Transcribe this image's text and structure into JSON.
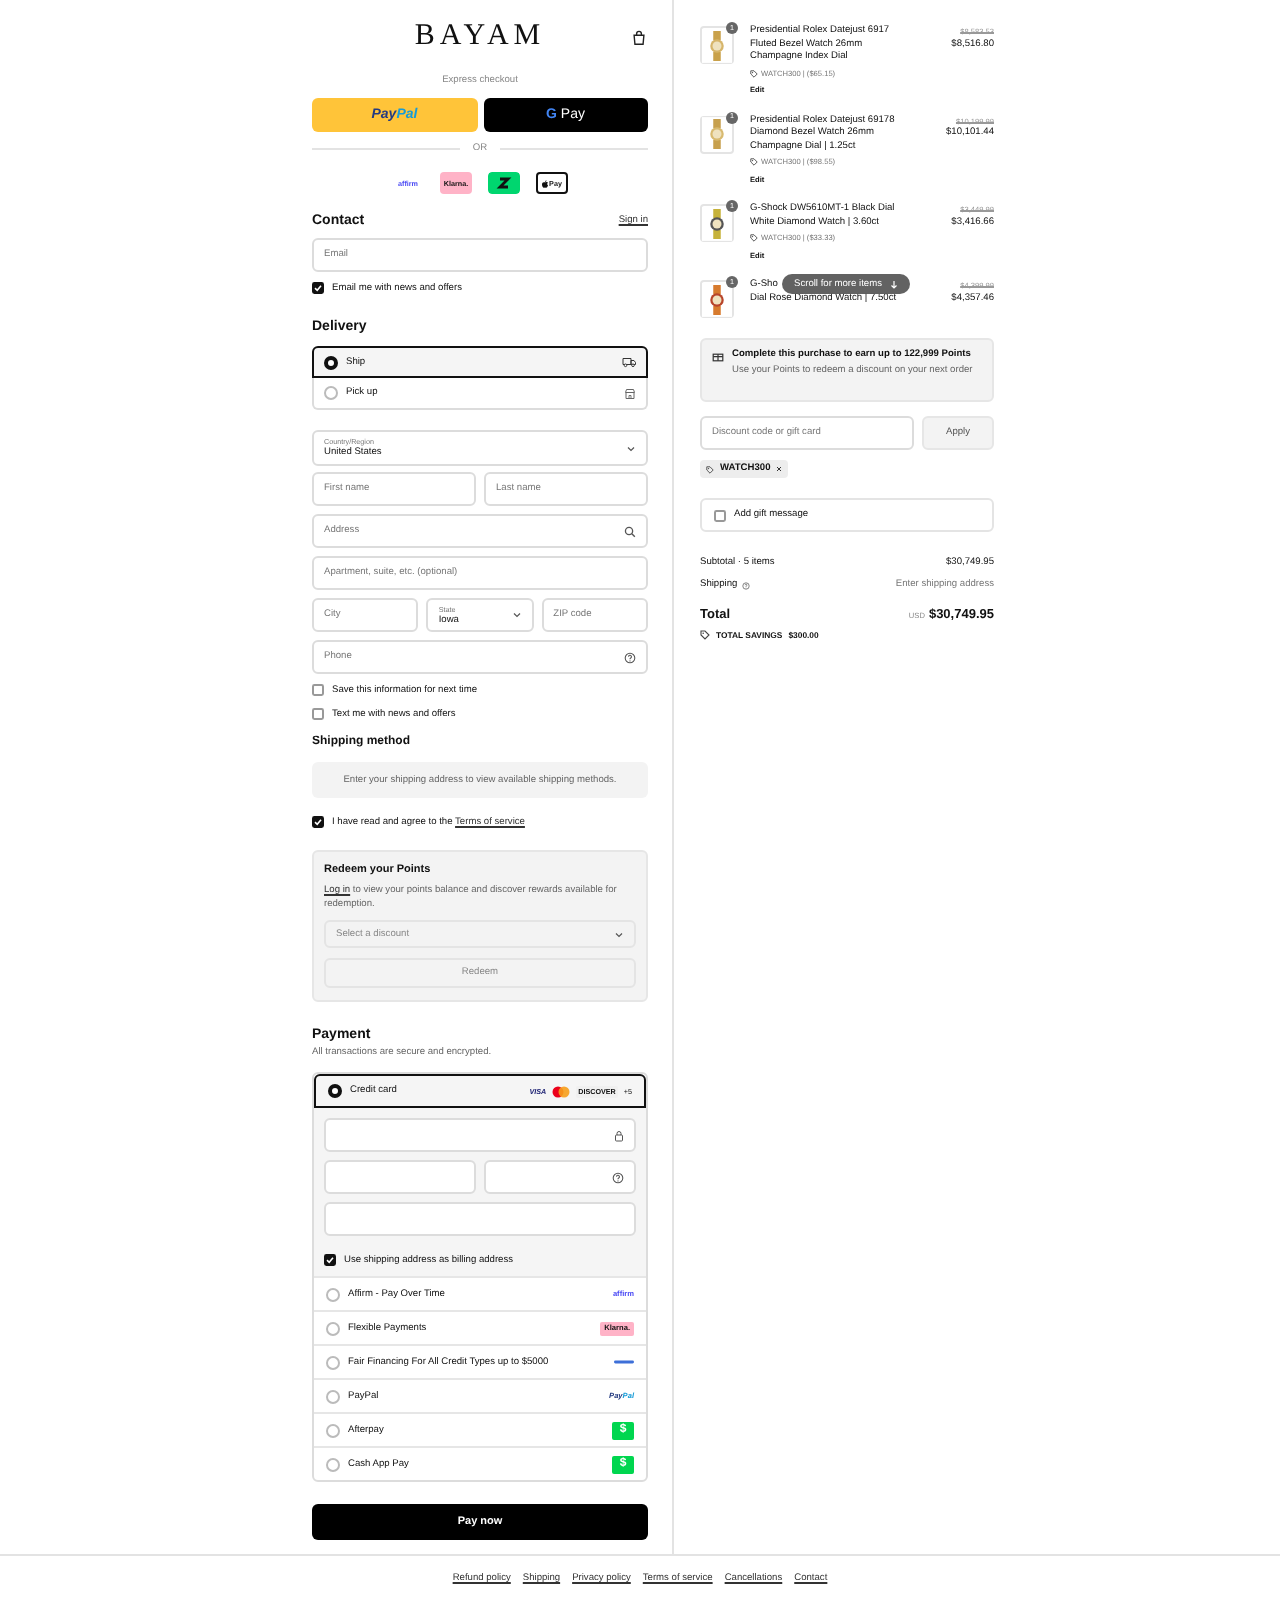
{
  "header": {
    "logo": "BAYAM"
  },
  "express": {
    "label": "Express checkout",
    "buttons": [
      {
        "kind": "paypal",
        "label": "Pay",
        "label_2": "Pal"
      },
      {
        "kind": "gpay",
        "mark": "G",
        "label": "Pay"
      }
    ],
    "divider": "OR",
    "methods": [
      {
        "kind": "affirm",
        "label": "affirm"
      },
      {
        "kind": "klarna",
        "label": "Klarna."
      },
      {
        "kind": "sezzle"
      },
      {
        "kind": "applepay",
        "label": "Pay"
      }
    ]
  },
  "contact": {
    "title": "Contact",
    "link": "Sign in",
    "email": {
      "placeholder": "Email"
    },
    "news": {
      "label": "Email me with news and offers",
      "checked": true
    }
  },
  "delivery": {
    "title": "Delivery",
    "options": [
      {
        "kind": "ship",
        "label": "Ship",
        "selected": true
      },
      {
        "kind": "pickup",
        "label": "Pick up",
        "selected": false
      }
    ],
    "country": {
      "label": "Country/Region",
      "value": "United States"
    },
    "first_name": {
      "placeholder": "First name"
    },
    "last_name": {
      "placeholder": "Last name"
    },
    "address": {
      "placeholder": "Address"
    },
    "apartment": {
      "placeholder": "Apartment, suite, etc. (optional)"
    },
    "city": {
      "placeholder": "City"
    },
    "state": {
      "label": "State",
      "value": "Iowa"
    },
    "zip": {
      "placeholder": "ZIP code"
    },
    "phone": {
      "placeholder": "Phone"
    },
    "save": {
      "label": "Save this information for next time",
      "checked": false
    },
    "text_me": {
      "label": "Text me with news and offers",
      "checked": false
    }
  },
  "shipping_method": {
    "title": "Shipping method",
    "note": "Enter your shipping address to view available shipping methods."
  },
  "terms": {
    "text": "I have read and agree to the",
    "link": "Terms of service",
    "checked": true
  },
  "redeem": {
    "title": "Redeem your Points",
    "link": "Log in",
    "text": "to view your points balance and discover rewards available for redemption.",
    "select": {
      "placeholder": "Select a discount"
    },
    "button": "Redeem"
  },
  "payment": {
    "title": "Payment",
    "subtitle": "All transactions are secure and encrypted.",
    "methods": [
      {
        "kind": "card",
        "label": "Credit card",
        "selected": true,
        "badges": [
          "VISA",
          "DISCOVER",
          "+5"
        ]
      },
      {
        "kind": "affirm",
        "label": "Affirm - Pay Over Time",
        "selected": false,
        "logo": "affirm"
      },
      {
        "kind": "klarna",
        "label": "Flexible Payments",
        "selected": false,
        "logo": "Klarna."
      },
      {
        "kind": "sezzle",
        "label": "Fair Financing For All Credit Types up to $5000",
        "selected": false
      },
      {
        "kind": "paypal",
        "label": "PayPal",
        "selected": false,
        "logo": "Pay",
        "logo_2": "Pal"
      },
      {
        "kind": "afterpay",
        "label": "Afterpay",
        "selected": false,
        "logo": "$"
      },
      {
        "kind": "cashapp",
        "label": "Cash App Pay",
        "selected": false,
        "logo": "$"
      }
    ],
    "billing": {
      "label": "Use shipping address as billing address",
      "checked": true
    },
    "pay_button": "Pay now"
  },
  "summary": {
    "items": [
      {
        "quantity": "1",
        "name": "Presidential Rolex Datejust 6917 Fluted Bezel Watch 26mm Champagne Index Dial",
        "original_price": "$8,583.53",
        "price": "$8,516.80",
        "discount": "WATCH300 | ($65.15)",
        "edit": "Edit"
      },
      {
        "quantity": "1",
        "name": "Presidential Rolex Datejust 69178 Diamond Bezel Watch 26mm Champagne Dial | 1.25ct",
        "original_price": "$10,199.99",
        "price": "$10,101.44",
        "discount": "WATCH300 | ($98.55)",
        "edit": "Edit"
      },
      {
        "quantity": "1",
        "name": "G-Shock DW5610MT-1 Black Dial White Diamond Watch | 3.60ct",
        "original_price": "$3,449.99",
        "price": "$3,416.66",
        "discount": "WATCH300 | ($33.33)",
        "edit": "Edit"
      },
      {
        "quantity": "1",
        "name": "G-Sho",
        "name_rest": "Dial Rose Diamond Watch | 7.50ct",
        "original_price": "$4,399.99",
        "price": "$4,357.46"
      }
    ],
    "scroll_hint": "Scroll for more items",
    "points": {
      "title": "Complete this purchase to earn up to 122,999 Points",
      "subtitle": "Use your Points to redeem a discount on your next order"
    },
    "discount": {
      "placeholder": "Discount code or gift card",
      "button": "Apply",
      "tags": [
        "WATCH300"
      ]
    },
    "gift": {
      "label": "Add gift message",
      "checked": false
    },
    "subtotal": {
      "label": "Subtotal · 5 items",
      "value": "$30,749.95"
    },
    "shipping": {
      "label": "Shipping",
      "value": "Enter shipping address"
    },
    "total": {
      "label": "Total",
      "currency": "USD",
      "value": "$30,749.95"
    },
    "savings": {
      "label": "TOTAL SAVINGS",
      "value": "$300.00"
    }
  },
  "footer": {
    "links": [
      "Refund policy",
      "Shipping",
      "Privacy policy",
      "Terms of service",
      "Cancellations",
      "Contact"
    ]
  }
}
